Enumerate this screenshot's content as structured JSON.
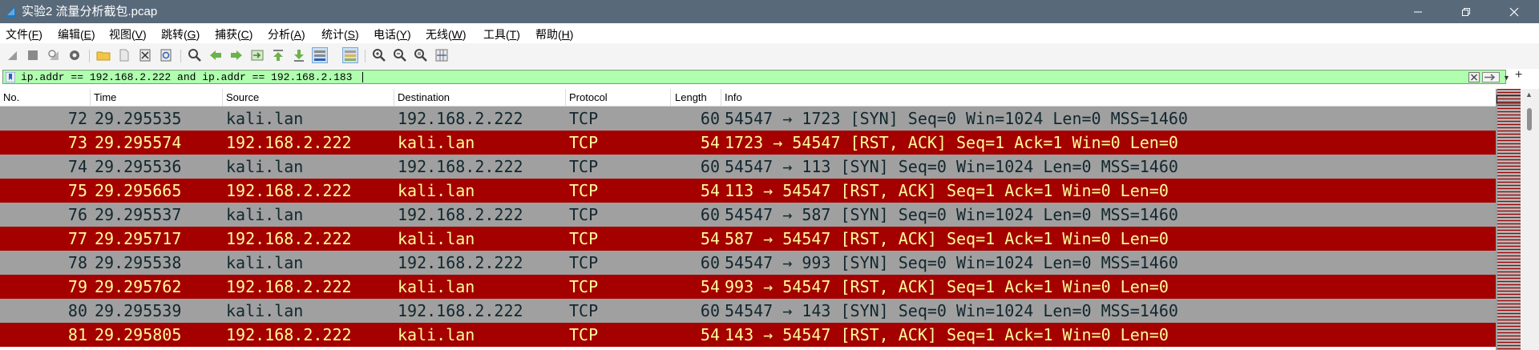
{
  "window": {
    "title": "实验2 流量分析截包.pcap",
    "minimize_glyph": "—",
    "maximize_glyph": "❐",
    "close_glyph": "✕"
  },
  "menu": [
    {
      "label": "文件(",
      "key": "F",
      "end": ")"
    },
    {
      "label": "编辑(",
      "key": "E",
      "end": ")"
    },
    {
      "label": "视图(",
      "key": "V",
      "end": ")"
    },
    {
      "label": "跳转(",
      "key": "G",
      "end": ")"
    },
    {
      "label": "捕获(",
      "key": "C",
      "end": ")"
    },
    {
      "label": "分析(",
      "key": "A",
      "end": ")"
    },
    {
      "label": "统计(",
      "key": "S",
      "end": ")"
    },
    {
      "label": "电话(",
      "key": "Y",
      "end": ")"
    },
    {
      "label": "无线(",
      "key": "W",
      "end": ")"
    },
    {
      "label": "工具(",
      "key": "T",
      "end": ")"
    },
    {
      "label": "帮助(",
      "key": "H",
      "end": ")"
    }
  ],
  "toolbar_icons": [
    "start-capture-icon",
    "stop-capture-icon",
    "restart-capture-icon",
    "capture-options-icon",
    "open-file-icon",
    "save-file-icon",
    "close-file-icon",
    "reload-file-icon",
    "find-packet-icon",
    "go-back-icon",
    "go-forward-icon",
    "go-to-packet-icon",
    "first-packet-icon",
    "last-packet-icon",
    "autoscroll-icon",
    "colorize-icon",
    "zoom-in-icon",
    "zoom-out-icon",
    "normal-size-icon",
    "resize-columns-icon"
  ],
  "filter": {
    "value": "ip.addr == 192.168.2.222 and ip.addr == 192.168.2.183",
    "background": "#afffaf"
  },
  "columns": [
    "No.",
    "Time",
    "Source",
    "Destination",
    "Protocol",
    "Length",
    "Info"
  ],
  "colors": {
    "row_gray_bg": "#a0a0a0",
    "row_gray_fg": "#12272e",
    "row_red_bg": "#a40000",
    "row_red_fg": "#fffc9c",
    "titlebar": "#58697a"
  },
  "packets": [
    {
      "no": "72",
      "time": "29.295535",
      "source": "kali.lan",
      "destination": "192.168.2.222",
      "protocol": "TCP",
      "length": "60",
      "info": "54547 → 1723 [SYN] Seq=0 Win=1024 Len=0 MSS=1460",
      "color": "gray"
    },
    {
      "no": "73",
      "time": "29.295574",
      "source": "192.168.2.222",
      "destination": "kali.lan",
      "protocol": "TCP",
      "length": "54",
      "info": "1723 → 54547 [RST, ACK] Seq=1 Ack=1 Win=0 Len=0",
      "color": "red"
    },
    {
      "no": "74",
      "time": "29.295536",
      "source": "kali.lan",
      "destination": "192.168.2.222",
      "protocol": "TCP",
      "length": "60",
      "info": "54547 → 113 [SYN] Seq=0 Win=1024 Len=0 MSS=1460",
      "color": "gray"
    },
    {
      "no": "75",
      "time": "29.295665",
      "source": "192.168.2.222",
      "destination": "kali.lan",
      "protocol": "TCP",
      "length": "54",
      "info": "113 → 54547 [RST, ACK] Seq=1 Ack=1 Win=0 Len=0",
      "color": "red"
    },
    {
      "no": "76",
      "time": "29.295537",
      "source": "kali.lan",
      "destination": "192.168.2.222",
      "protocol": "TCP",
      "length": "60",
      "info": "54547 → 587 [SYN] Seq=0 Win=1024 Len=0 MSS=1460",
      "color": "gray"
    },
    {
      "no": "77",
      "time": "29.295717",
      "source": "192.168.2.222",
      "destination": "kali.lan",
      "protocol": "TCP",
      "length": "54",
      "info": "587 → 54547 [RST, ACK] Seq=1 Ack=1 Win=0 Len=0",
      "color": "red"
    },
    {
      "no": "78",
      "time": "29.295538",
      "source": "kali.lan",
      "destination": "192.168.2.222",
      "protocol": "TCP",
      "length": "60",
      "info": "54547 → 993 [SYN] Seq=0 Win=1024 Len=0 MSS=1460",
      "color": "gray"
    },
    {
      "no": "79",
      "time": "29.295762",
      "source": "192.168.2.222",
      "destination": "kali.lan",
      "protocol": "TCP",
      "length": "54",
      "info": "993 → 54547 [RST, ACK] Seq=1 Ack=1 Win=0 Len=0",
      "color": "red"
    },
    {
      "no": "80",
      "time": "29.295539",
      "source": "kali.lan",
      "destination": "192.168.2.222",
      "protocol": "TCP",
      "length": "60",
      "info": "54547 → 143 [SYN] Seq=0 Win=1024 Len=0 MSS=1460",
      "color": "gray"
    },
    {
      "no": "81",
      "time": "29.295805",
      "source": "192.168.2.222",
      "destination": "kali.lan",
      "protocol": "TCP",
      "length": "54",
      "info": "143 → 54547 [RST, ACK] Seq=1 Ack=1 Win=0 Len=0",
      "color": "red"
    }
  ]
}
